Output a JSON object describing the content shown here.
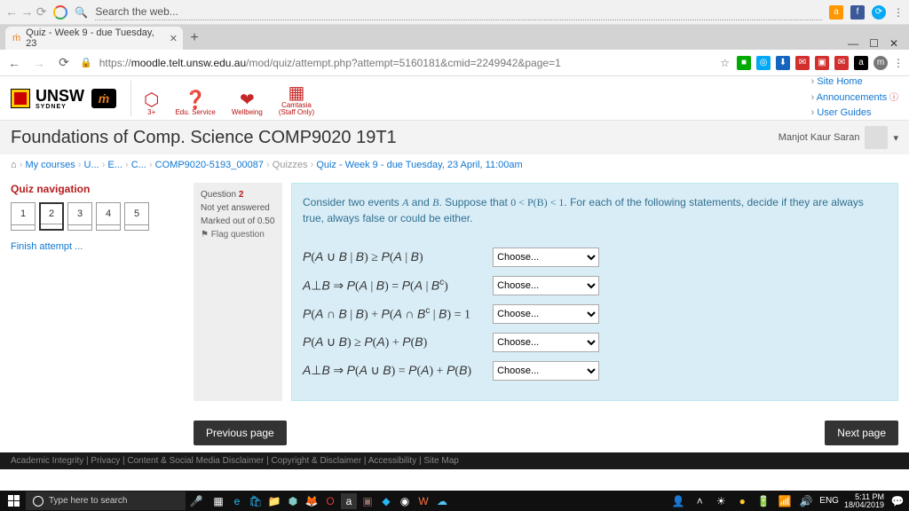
{
  "omnibox": {
    "search_placeholder": "Search the web..."
  },
  "tab": {
    "title": "Quiz - Week 9 - due Tuesday, 23"
  },
  "window": {
    "min": "—",
    "max": "☐",
    "close": "✕"
  },
  "addr": {
    "scheme": "https://",
    "host": "moodle.telt.unsw.edu.au",
    "path": "/mod/quiz/attempt.php?attempt=5160181&cmid=2249942&page=1"
  },
  "unsw": {
    "logo_text": "UNSW",
    "syd": "SYDNEY",
    "svc": [
      {
        "icon": "⬡",
        "label": "3+"
      },
      {
        "icon": "❓",
        "label": "Edu. Service"
      },
      {
        "icon": "❤",
        "label": "Wellbeing"
      },
      {
        "icon": "▦",
        "label": "Camtasia\n(Staff Only)"
      }
    ],
    "side": {
      "home": "Site Home",
      "ann": "Announcements",
      "guides": "User Guides"
    }
  },
  "course": {
    "title": "Foundations of Comp. Science COMP9020 19T1",
    "user": "Manjot Kaur Saran"
  },
  "crumbs": {
    "items": [
      "My courses",
      "U...",
      "E...",
      "C...",
      "COMP9020-5193_00087",
      "Quizzes",
      "Quiz - Week 9 - due Tuesday, 23 April, 11:00am"
    ]
  },
  "qnav": {
    "title": "Quiz navigation",
    "buttons": [
      "1",
      "2",
      "3",
      "4",
      "5"
    ],
    "current": 1,
    "finish": "Finish attempt ..."
  },
  "qinfo": {
    "qlabel": "Question",
    "qnum": "2",
    "state": "Not yet answered",
    "mark": "Marked out of 0.50",
    "flag": "Flag question"
  },
  "question": {
    "prompt_pre": "Consider two events ",
    "varA": "A",
    "prompt_and": " and ",
    "varB": "B",
    "prompt_mid": ". Suppose that ",
    "cond": "0 < P(B) < 1",
    "prompt_post": ". For each of the following statements, decide if they are always true, always false or could be either.",
    "statements": [
      "P(A ∪ B | B) ≥ P(A | B)",
      "A⊥B  ⇒  P(A | B) = P(A | Bᶜ)",
      "P(A ∩ B | B) + P(A ∩ Bᶜ | B) = 1",
      "P(A ∪ B) ≥ P(A) + P(B)",
      "A⊥B  ⇒  P(A ∪ B) = P(A) + P(B)"
    ],
    "choose": "Choose..."
  },
  "pagenav": {
    "prev": "Previous page",
    "next": "Next page"
  },
  "footer": {
    "links": "Academic Integrity   |   Privacy   |   Content & Social Media Disclaimer   |   Copyright & Disclaimer   |   Accessibility   |   Site Map"
  },
  "taskbar": {
    "search": "Type here to search",
    "lang": "ENG",
    "time": "5:11 PM",
    "date": "18/04/2019"
  }
}
